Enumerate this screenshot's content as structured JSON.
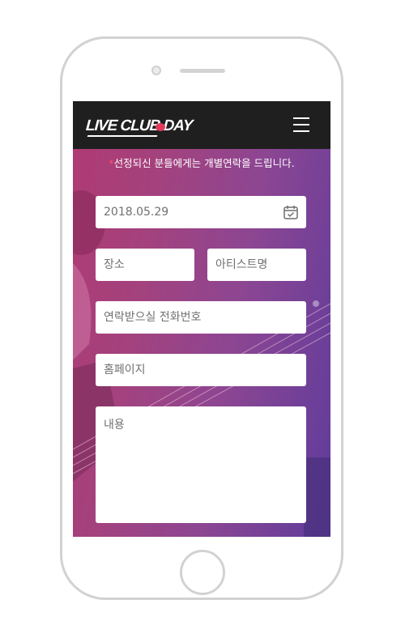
{
  "header": {
    "logo_text": "LIVE CLUB DAY"
  },
  "notice": {
    "star": "*",
    "text": "선정되신 분들에게는 개별연락을 드립니다."
  },
  "form": {
    "date_value": "2018.05.29",
    "place_placeholder": "장소",
    "artist_placeholder": "아티스트명",
    "phone_placeholder": "연락받으실 전화번호",
    "homepage_placeholder": "홈페이지",
    "content_placeholder": "내용"
  },
  "icons": {
    "menu": "hamburger-menu-icon",
    "calendar": "calendar-check-icon"
  },
  "colors": {
    "header_bg": "#1f1f1f",
    "gradient_start": "#b03a72",
    "gradient_end": "#5f3c9c",
    "accent_star": "#ff4d6d"
  }
}
